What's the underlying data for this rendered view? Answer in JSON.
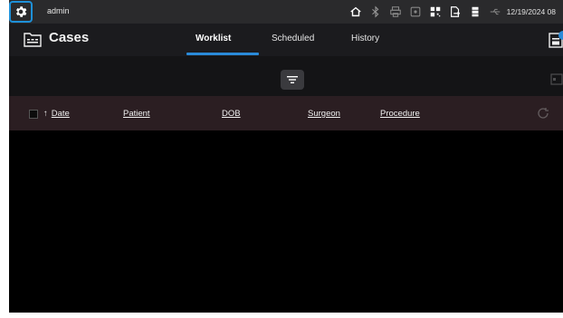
{
  "status_bar": {
    "user": "admin",
    "datetime": "12/19/2024 08",
    "icons": [
      "home-icon",
      "bluetooth-icon",
      "printer-icon",
      "record-icon",
      "qr-code-icon",
      "file-export-icon",
      "server-icon",
      "usb-icon"
    ]
  },
  "header": {
    "title": "Cases",
    "tabs": [
      {
        "label": "Worklist",
        "active": true
      },
      {
        "label": "Scheduled",
        "active": false
      },
      {
        "label": "History",
        "active": false
      }
    ]
  },
  "table": {
    "columns": [
      "Date",
      "Patient",
      "DOB",
      "Surgeon",
      "Procedure"
    ],
    "sort": {
      "column": "Date",
      "direction": "ascending",
      "arrow": "↑"
    },
    "rows": []
  },
  "colors": {
    "accent": "#2a8ad8",
    "status_bar_bg": "#2a2a2c",
    "header_bg": "#1b1b1e",
    "table_header_bg": "#2b1e22",
    "body_bg": "#000000"
  }
}
